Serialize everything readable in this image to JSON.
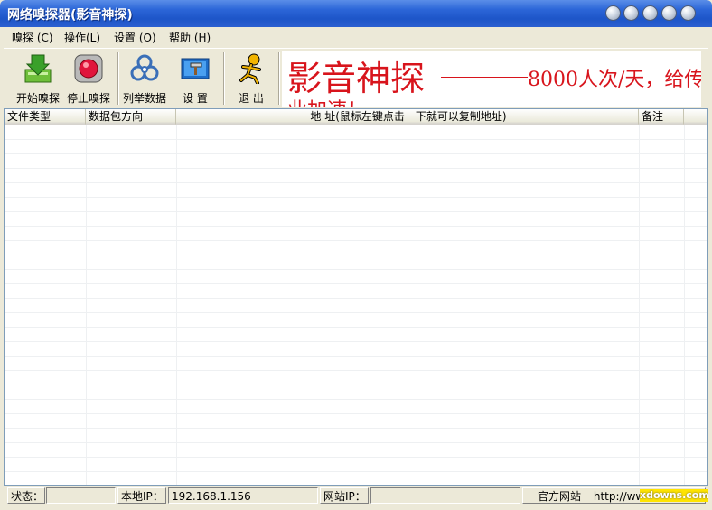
{
  "window": {
    "title": "网络嗅探器(影音神探)"
  },
  "menu": [
    {
      "label": "嗅探 (C)"
    },
    {
      "label": "操作(L)"
    },
    {
      "label": "设置 (O)"
    },
    {
      "label": "帮助 (H)"
    }
  ],
  "toolbar": {
    "start": "开始嗅探",
    "stop": "停止嗅探",
    "list": "列举数据",
    "settings": "设  置",
    "exit": "退  出"
  },
  "banner": {
    "title": "影音神探",
    "tagline": "8000人次/天，给传",
    "second_line": "业加速！"
  },
  "table": {
    "columns": [
      "文件类型",
      "数据包方向",
      "地    址(鼠标左键点击一下就可以复制地址)",
      "备注"
    ]
  },
  "status": {
    "state_label": "状态：",
    "state_value": "",
    "local_ip_label": "本地IP：",
    "local_ip_value": "192.168.1.156",
    "site_ip_label": "网站IP：",
    "site_ip_value": "",
    "official_label": "官方网站",
    "official_value": "http://www.",
    "watermark": "xdowns.com"
  },
  "colors": {
    "titlebar": "#2c66d8",
    "banner_text": "#d8141c",
    "grid_border": "#7f9db9"
  },
  "icons": [
    "start-sniff-icon",
    "stop-sniff-icon",
    "biohazard-icon",
    "settings-monitor-icon",
    "running-man-icon"
  ]
}
